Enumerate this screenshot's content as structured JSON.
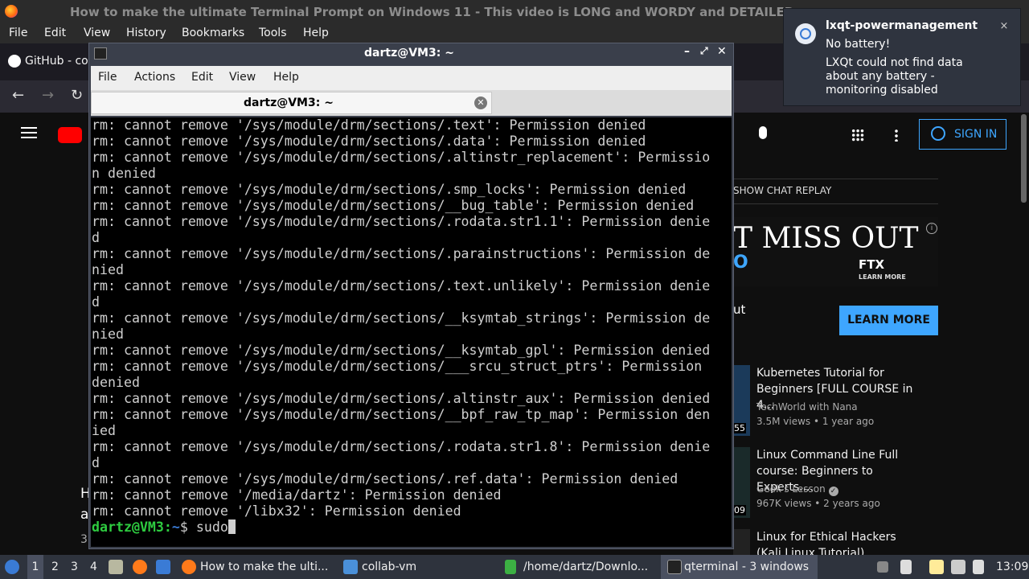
{
  "firefox": {
    "window_title": "How to make the ultimate Terminal Prompt on Windows 11 - This video is LONG and WORDY and DETAILED -",
    "menu": [
      "File",
      "Edit",
      "View",
      "History",
      "Bookmarks",
      "Tools",
      "Help"
    ],
    "tab_label": "GitHub - co"
  },
  "youtube": {
    "sign_in": "SIGN IN",
    "show_chat_replay": "SHOW CHAT REPLAY",
    "ad_text": "T MISS OUT",
    "ad_brand": "FTX",
    "ad_sub": "LEARN MORE",
    "ad_left_fragment": "O",
    "learn_more": "LEARN MORE",
    "partial_text": "ut",
    "left_fragments": [
      "H",
      "a",
      "3"
    ],
    "recommendations": [
      {
        "title": "Kubernetes Tutorial for Beginners [FULL COURSE in 4...",
        "channel": "TechWorld with Nana",
        "meta": "3.5M views • 1 year ago",
        "badge": "55"
      },
      {
        "title": "Linux Command Line Full course: Beginners to Experts....",
        "channel": "Geek's Lesson",
        "meta": "967K views • 2 years ago",
        "badge": "09"
      },
      {
        "title": "Linux for Ethical Hackers (Kali Linux Tutorial)",
        "channel": "",
        "meta": "",
        "badge": ""
      }
    ]
  },
  "notification": {
    "app": "lxqt-powermanagement",
    "summary": "No battery!",
    "body": "LXQt could not find data about any battery - monitoring disabled",
    "close": "×"
  },
  "terminal": {
    "title": "dartz@VM3: ~",
    "menu": [
      "File",
      "Actions",
      "Edit",
      "View",
      "Help"
    ],
    "tab_label": "dartz@VM3: ~",
    "lines": [
      "rm: cannot remove '/sys/module/drm/sections/.text': Permission denied",
      "rm: cannot remove '/sys/module/drm/sections/.data': Permission denied",
      "rm: cannot remove '/sys/module/drm/sections/.altinstr_replacement': Permissio",
      "n denied",
      "rm: cannot remove '/sys/module/drm/sections/.smp_locks': Permission denied",
      "rm: cannot remove '/sys/module/drm/sections/__bug_table': Permission denied",
      "rm: cannot remove '/sys/module/drm/sections/.rodata.str1.1': Permission denie",
      "d",
      "rm: cannot remove '/sys/module/drm/sections/.parainstructions': Permission de",
      "nied",
      "rm: cannot remove '/sys/module/drm/sections/.text.unlikely': Permission denie",
      "d",
      "rm: cannot remove '/sys/module/drm/sections/__ksymtab_strings': Permission de",
      "nied",
      "rm: cannot remove '/sys/module/drm/sections/__ksymtab_gpl': Permission denied",
      "rm: cannot remove '/sys/module/drm/sections/___srcu_struct_ptrs': Permission",
      "denied",
      "rm: cannot remove '/sys/module/drm/sections/.altinstr_aux': Permission denied",
      "rm: cannot remove '/sys/module/drm/sections/__bpf_raw_tp_map': Permission den",
      "ied",
      "rm: cannot remove '/sys/module/drm/sections/.rodata.str1.8': Permission denie",
      "d",
      "rm: cannot remove '/sys/module/drm/sections/.ref.data': Permission denied",
      "rm: cannot remove '/media/dartz': Permission denied",
      "rm: cannot remove '/libx32': Permission denied"
    ],
    "prompt_user": "dartz@VM3",
    "prompt_sep": ":",
    "prompt_path": "~",
    "prompt_symbol": "$ ",
    "command": "sudo"
  },
  "taskbar": {
    "workspaces": [
      "1",
      "2",
      "3",
      "4"
    ],
    "tasks": [
      {
        "label": "How to make the ulti...",
        "icon": "firefox-icon"
      },
      {
        "label": "collab-vm",
        "icon": "folder-icon"
      },
      {
        "label": "/home/dartz/Downlo...",
        "icon": "file-manager-icon"
      },
      {
        "label": "qterminal - 3 windows",
        "icon": "terminal-icon"
      }
    ],
    "clock": "13:09"
  }
}
